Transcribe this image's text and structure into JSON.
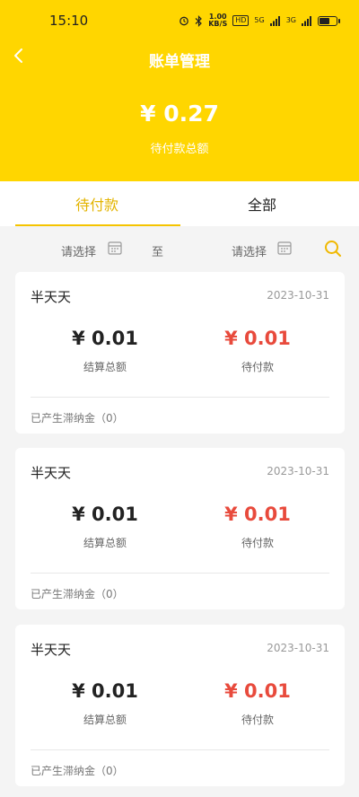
{
  "status": {
    "time": "15:10",
    "speed_value": "1.00",
    "speed_unit": "KB/S",
    "hd": "HD",
    "net1": "5G",
    "net2": "3G"
  },
  "header": {
    "title": "账单管理",
    "total_amount": "¥ 0.27",
    "total_label": "待付款总额"
  },
  "tabs": [
    {
      "label": "待付款",
      "active": true
    },
    {
      "label": "全部",
      "active": false
    }
  ],
  "filter": {
    "start_placeholder": "请选择",
    "separator": "至",
    "end_placeholder": "请选择"
  },
  "bills": [
    {
      "shop": "半天天",
      "date": "2023-10-31",
      "settle_amount": "¥ 0.01",
      "settle_label": "结算总额",
      "pending_amount": "¥ 0.01",
      "pending_label": "待付款",
      "late_fee": "已产生滞纳金（0）"
    },
    {
      "shop": "半天天",
      "date": "2023-10-31",
      "settle_amount": "¥ 0.01",
      "settle_label": "结算总额",
      "pending_amount": "¥ 0.01",
      "pending_label": "待付款",
      "late_fee": "已产生滞纳金（0）"
    },
    {
      "shop": "半天天",
      "date": "2023-10-31",
      "settle_amount": "¥ 0.01",
      "settle_label": "结算总额",
      "pending_amount": "¥ 0.01",
      "pending_label": "待付款",
      "late_fee": "已产生滞纳金（0）"
    }
  ],
  "colors": {
    "brand_yellow": "#ffd600",
    "tab_active": "#e3b400",
    "pending_red": "#e84a3c"
  },
  "icons": [
    "back-arrow-icon",
    "calendar-icon",
    "search-icon",
    "alarm-icon",
    "bluetooth-icon",
    "signal-icon",
    "battery-icon"
  ]
}
